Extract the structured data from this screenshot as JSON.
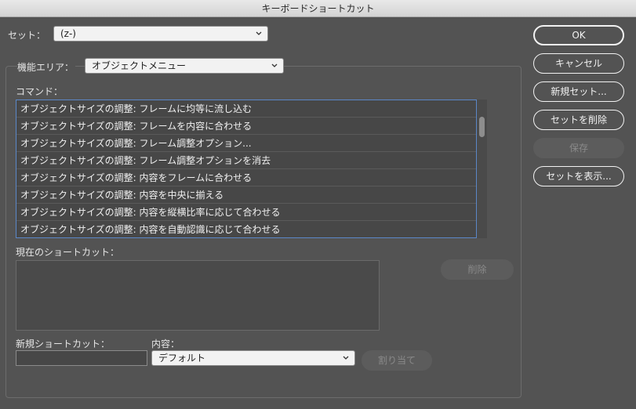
{
  "window": {
    "title": "キーボードショートカット"
  },
  "set": {
    "label": "セット：",
    "selected": "(z-)"
  },
  "area": {
    "label": "機能エリア：",
    "selected": "オブジェクトメニュー"
  },
  "commands": {
    "label": "コマンド：",
    "items": [
      "オブジェクトサイズの調整: フレームに均等に流し込む",
      "オブジェクトサイズの調整: フレームを内容に合わせる",
      "オブジェクトサイズの調整: フレーム調整オプション...",
      "オブジェクトサイズの調整: フレーム調整オプションを消去",
      "オブジェクトサイズの調整: 内容をフレームに合わせる",
      "オブジェクトサイズの調整: 内容を中央に揃える",
      "オブジェクトサイズの調整: 内容を縦横比率に応じて合わせる",
      "オブジェクトサイズの調整: 内容を自動認識に応じて合わせる"
    ]
  },
  "current": {
    "label": "現在のショートカット：",
    "delete_label": "削除"
  },
  "new_shortcut": {
    "label": "新規ショートカット：",
    "value": ""
  },
  "context": {
    "label": "内容：",
    "selected": "デフォルト"
  },
  "assign_label": "割り当て",
  "buttons": {
    "ok": "OK",
    "cancel": "キャンセル",
    "new_set": "新規セット...",
    "delete_set": "セットを削除",
    "save": "保存",
    "show_set": "セットを表示..."
  }
}
